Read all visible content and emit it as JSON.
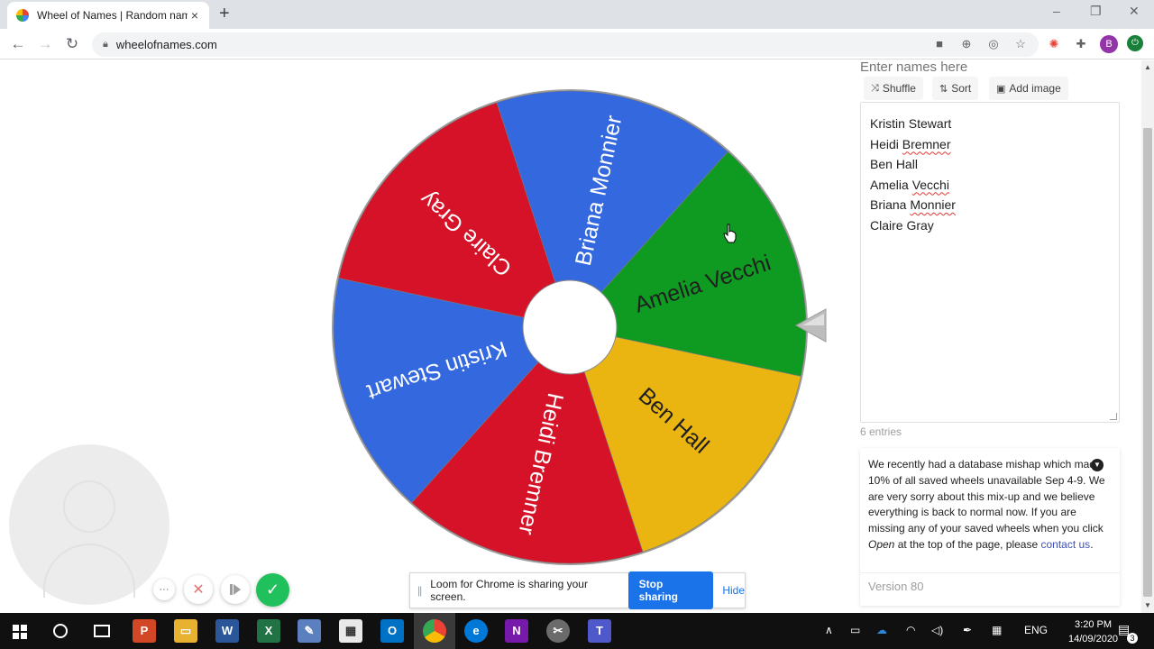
{
  "browser": {
    "tab_title": "Wheel of Names | Random name",
    "tab_close": "×",
    "new_tab": "+",
    "url": "wheelofnames.com",
    "profile_initial": "B",
    "window_controls": [
      "–",
      "❐",
      "✕"
    ]
  },
  "wheel": {
    "segments": [
      {
        "label": "Amelia Vecchi",
        "color": "#0f9b22",
        "text_color": "#1f1f1f"
      },
      {
        "label": "Ben Hall",
        "color": "#eab411",
        "text_color": "#1f1f1f"
      },
      {
        "label": "Heidi Bremner",
        "color": "#d51228",
        "text_color": "#ffffff"
      },
      {
        "label": "Kristin Stewart",
        "color": "#3468de",
        "text_color": "#ffffff"
      },
      {
        "label": "Claire Gray",
        "color": "#d51228",
        "text_color": "#ffffff"
      },
      {
        "label": "Briana Monnier",
        "color": "#3468de",
        "text_color": "#ffffff"
      }
    ]
  },
  "editor": {
    "heading": "Enter names here",
    "shuffle_label": "Shuffle",
    "sort_label": "Sort",
    "add_image_label": "Add image",
    "names": [
      {
        "first": "Kristin",
        "last": "Stewart",
        "flag": false
      },
      {
        "first": "Heidi",
        "last": "Bremner",
        "flag": true
      },
      {
        "first": "Ben",
        "last": "Hall",
        "flag": false
      },
      {
        "first": "Amelia",
        "last": "Vecchi",
        "flag": true
      },
      {
        "first": "Briana",
        "last": "Monnier",
        "flag": true
      },
      {
        "first": "Claire",
        "last": "Gray",
        "flag": false
      }
    ],
    "entries_count": "6 entries"
  },
  "notice": {
    "text_before_open": "We recently had a database mishap which made 10% of all saved wheels unavailable Sep 4-9. We are very sorry about this mix-up and we believe everything is back to normal now. If you are missing any of your saved wheels when you click ",
    "open_word": "Open",
    "text_after_open": " at the top of the page, please ",
    "link_text": "contact us",
    "period": ".",
    "version": "Version 80"
  },
  "share_bar": {
    "message": "Loom for Chrome is sharing your screen.",
    "stop_label": "Stop sharing",
    "hide_label": "Hide"
  },
  "loom": {
    "more_label": "···",
    "cancel_label": "✕",
    "check_label": "✓"
  },
  "taskbar": {
    "language": "ENG",
    "time": "3:20 PM",
    "date": "14/09/2020",
    "notification_count": "3"
  }
}
